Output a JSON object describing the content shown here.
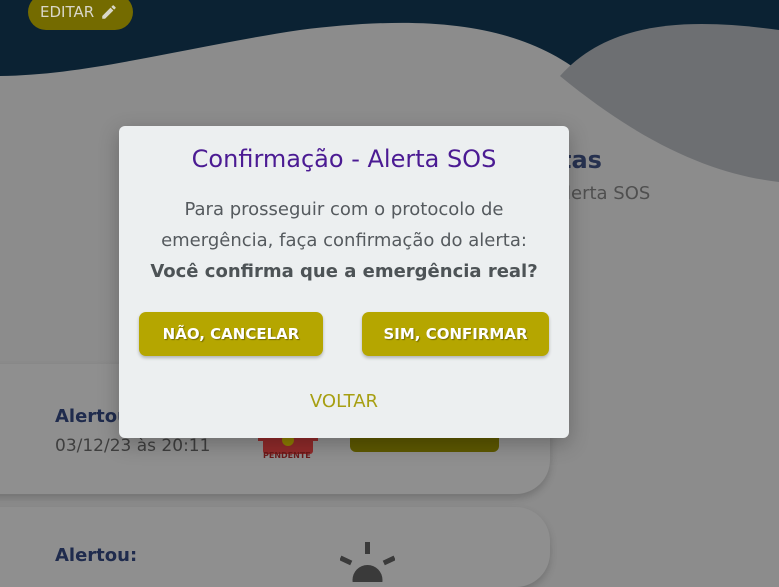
{
  "header": {
    "edit_label": "EDITAR"
  },
  "background": {
    "title_fragment": "tas",
    "subtitle_fragment": "lerta SOS",
    "cards": [
      {
        "label": "Alertou:",
        "date": "03/12/23 às 20:11",
        "status": "PENDENTE"
      },
      {
        "label": "Alertou:"
      }
    ]
  },
  "modal": {
    "title": "Confirmação - Alerta SOS",
    "line1": "Para prosseguir com o protocolo de",
    "line2": "emergência, faça confirmação do alerta:",
    "question": "Você confirma que a emergência real?",
    "cancel_label": "NÃO, CANCELAR",
    "confirm_label": "SIM, CONFIRMAR",
    "back_label": "VOLTAR"
  },
  "colors": {
    "overlay_bg": "#8c8c8c",
    "header_dark": "#0b2233",
    "modal_bg": "#eceff0",
    "title_purple": "#4b1b93",
    "button_olive": "#b5a600",
    "link_olive": "#a79f12"
  },
  "icons": [
    "pencil-icon",
    "pending-alert-icon",
    "sun-icon"
  ]
}
